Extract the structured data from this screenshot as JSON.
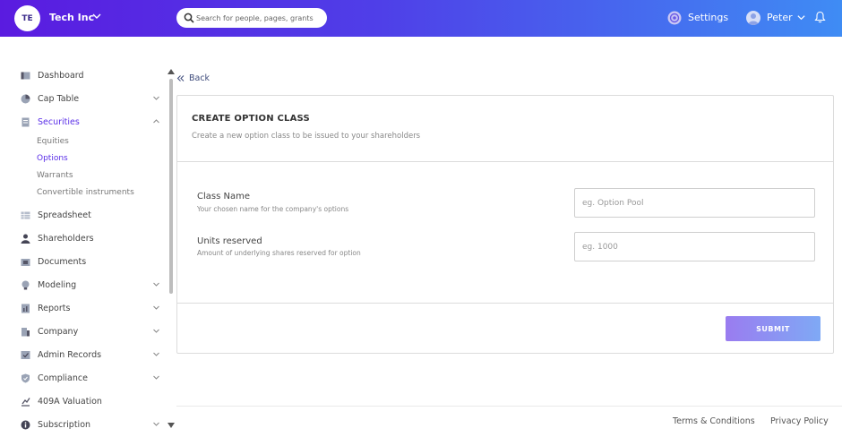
{
  "header": {
    "logo_initials": "TE",
    "company_name": "Tech Inc",
    "search_placeholder": "Search for people, pages, grants",
    "settings_label": "Settings",
    "user_name": "Peter"
  },
  "sidebar": {
    "items": [
      {
        "label": "Dashboard"
      },
      {
        "label": "Cap Table"
      },
      {
        "label": "Securities"
      },
      {
        "label": "Spreadsheet"
      },
      {
        "label": "Shareholders"
      },
      {
        "label": "Documents"
      },
      {
        "label": "Modeling"
      },
      {
        "label": "Reports"
      },
      {
        "label": "Company"
      },
      {
        "label": "Admin Records"
      },
      {
        "label": "Compliance"
      },
      {
        "label": "409A Valuation"
      },
      {
        "label": "Subscription"
      }
    ],
    "securities_sub": [
      "Equities",
      "Options",
      "Warrants",
      "Convertible instruments"
    ]
  },
  "main": {
    "back_label": "Back",
    "card_title": "CREATE OPTION CLASS",
    "card_subtitle": "Create a new option class to be issued to your shareholders",
    "fields": [
      {
        "label": "Class Name",
        "help": "Your chosen name for the company's options",
        "placeholder": "eg. Option Pool"
      },
      {
        "label": "Units reserved",
        "help": "Amount of underlying shares reserved for option",
        "placeholder": "eg. 1000"
      }
    ],
    "submit_label": "SUBMIT"
  },
  "footer": {
    "terms": "Terms & Conditions",
    "privacy": "Privacy Policy"
  },
  "colors": {
    "header_start": "#5a1be0",
    "header_end": "#3f8cf4",
    "active_nav": "#5a2ee8",
    "submit_start": "#9a7cf0",
    "submit_end": "#7fa9f5"
  }
}
